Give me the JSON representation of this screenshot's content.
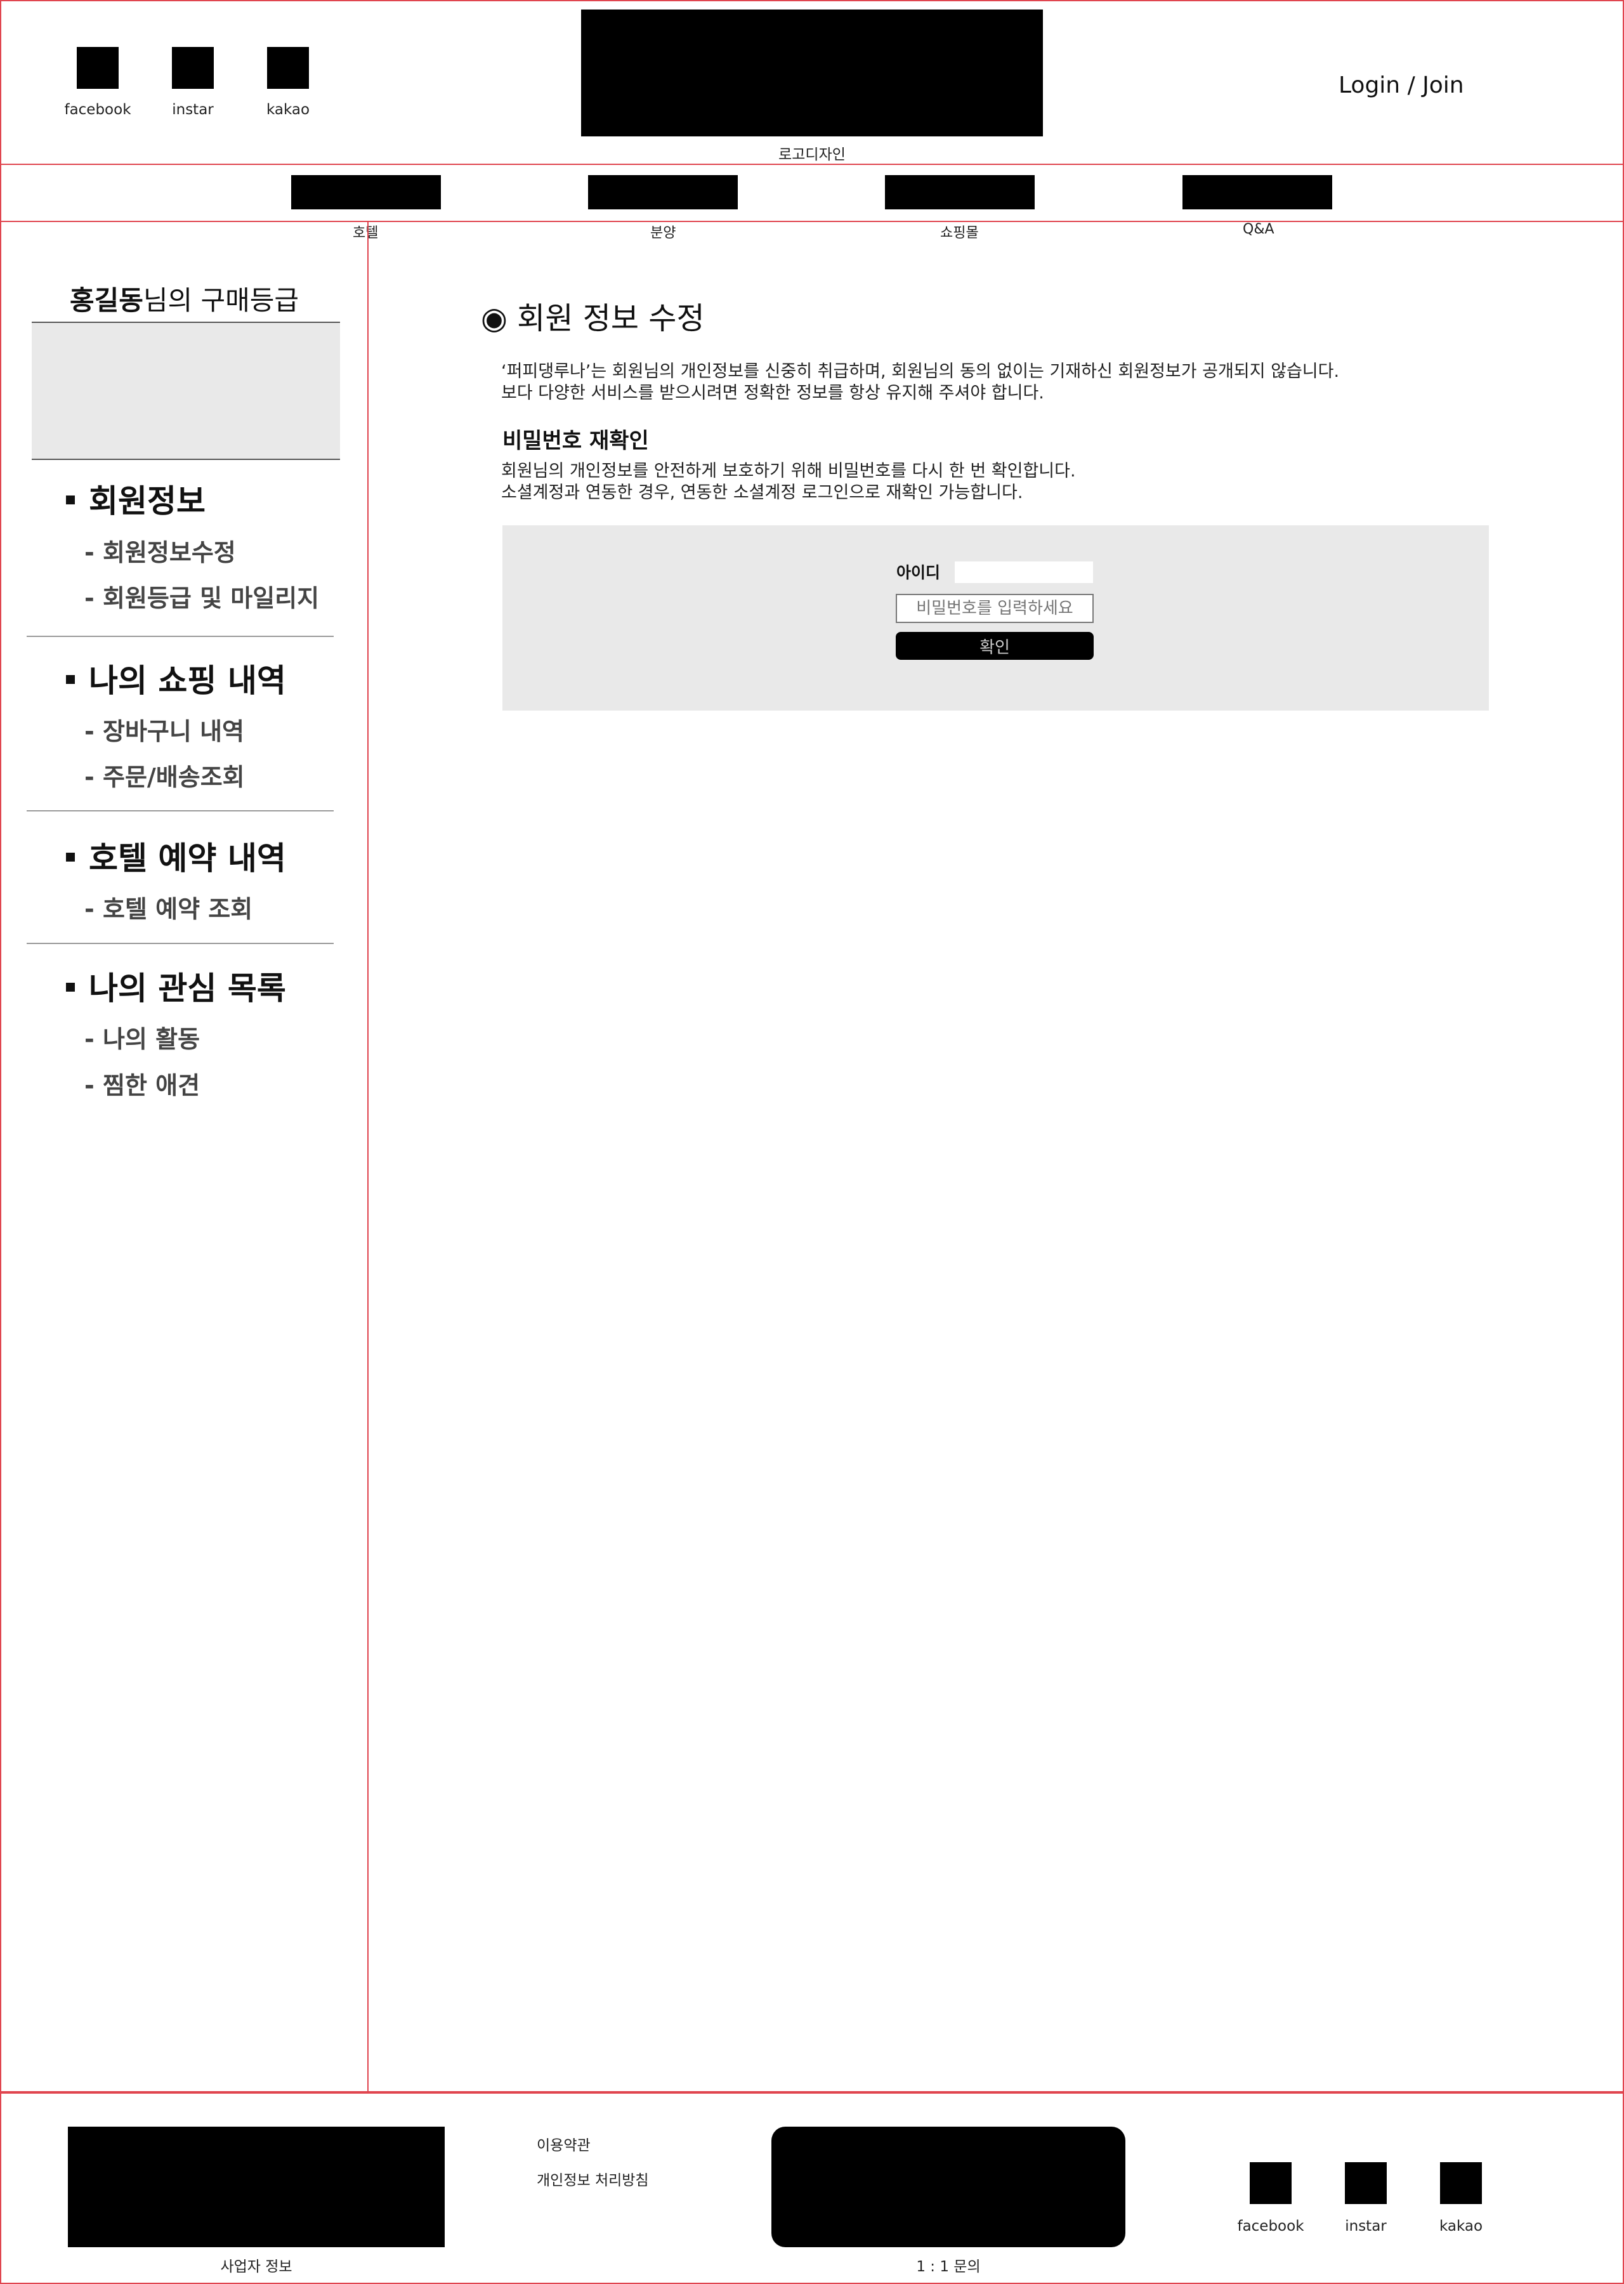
{
  "header": {
    "social": [
      {
        "label": "facebook",
        "icon": "facebook-icon"
      },
      {
        "label": "instar",
        "icon": "instagram-icon"
      },
      {
        "label": "kakao",
        "icon": "kakao-icon"
      }
    ],
    "logo_caption": "로고디자인",
    "login_join": "Login / Join"
  },
  "nav": {
    "items": [
      {
        "label": "호텔"
      },
      {
        "label": "분양"
      },
      {
        "label": "쇼핑몰"
      },
      {
        "label": "Q&A"
      }
    ]
  },
  "sidebar": {
    "user_name": "홍길동",
    "grade_suffix": "님의 구매등급",
    "sections": [
      {
        "title": "회원정보",
        "items": [
          "- 회원정보수정",
          "- 회원등급 및 마일리지"
        ]
      },
      {
        "title": "나의 쇼핑 내역",
        "items": [
          "- 장바구니 내역",
          "- 주문/배송조회"
        ]
      },
      {
        "title": "호텔 예약 내역",
        "items": [
          "- 호텔 예약 조회"
        ]
      },
      {
        "title": "나의 관심 목록",
        "items": [
          "- 나의 활동",
          "- 찜한 애견"
        ]
      }
    ]
  },
  "main": {
    "title_bullet": "◉",
    "title": "회원 정보 수정",
    "desc_line1": "‘퍼피댕루나’는 회원님의 개인정보를 신중히 취급하며, 회원님의 동의 없이는 기재하신 회원정보가 공개되지 않습니다.",
    "desc_line2": "보다 다양한 서비스를 받으시려면 정확한 정보를 항상 유지해 주셔야 합니다.",
    "subhead": "비밀번호 재확인",
    "sub_line1": "회원님의 개인정보를 안전하게 보호하기 위해 비밀번호를 다시 한 번 확인합니다.",
    "sub_line2": "소셜계정과 연동한 경우, 연동한 소셜계정 로그인으로 재확인 가능합니다.",
    "form": {
      "id_label": "아이디",
      "id_value": "",
      "pw_placeholder": "비밀번호를 입력하세요",
      "confirm_label": "확인"
    }
  },
  "footer": {
    "business_info": "사업자 정보",
    "terms": "이용약관",
    "privacy": "개인정보 처리방침",
    "inquiry": "1 : 1 문의",
    "social": [
      {
        "label": "facebook",
        "icon": "facebook-icon"
      },
      {
        "label": "instar",
        "icon": "instagram-icon"
      },
      {
        "label": "kakao",
        "icon": "kakao-icon"
      }
    ]
  }
}
